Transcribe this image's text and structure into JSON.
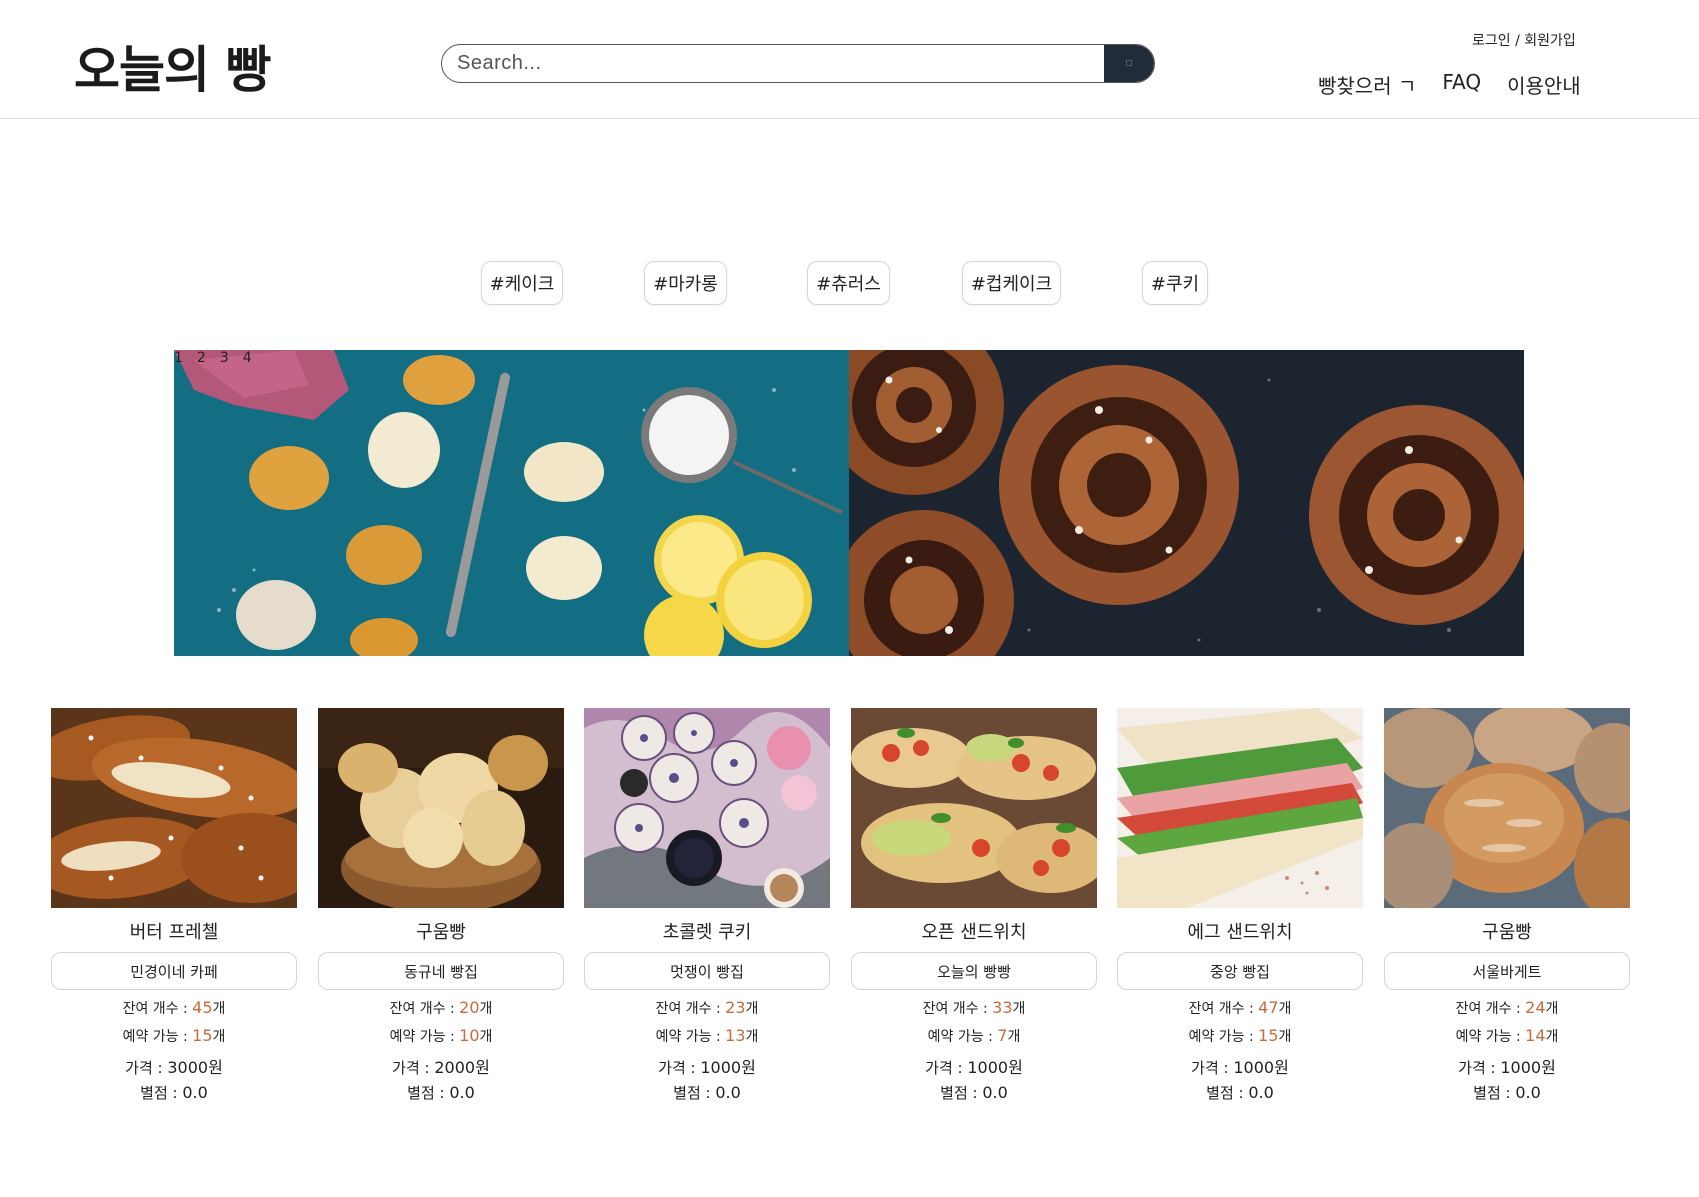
{
  "header": {
    "logo": "오늘의 빵",
    "search": {
      "placeholder": "Search...",
      "value": ""
    },
    "auth": {
      "login": "로그인",
      "separator": "/",
      "signup": "회원가입"
    },
    "nav": [
      "빵찾으러 ㄱ",
      "FAQ",
      "이용안내"
    ]
  },
  "tags": [
    "#케이크",
    "#마카롱",
    "#츄러스",
    "#컵케이크",
    "#쿠키"
  ],
  "slider": {
    "indicators": [
      "1",
      "2",
      "3",
      "4"
    ],
    "slides": [
      "madeleines-on-teal",
      "cinnamon-rolls-on-dark"
    ]
  },
  "products": [
    {
      "name": "버터 프레첼",
      "store": "민경이네 카페",
      "stock_label": "잔여 개수 : ",
      "stock": "45",
      "reserve_label": "예약 가능 : ",
      "reserve": "15",
      "unit": "개",
      "price_label": "가격 : ",
      "price": "3000원",
      "rating_label": "별점 : ",
      "rating": "0.0",
      "image": "pretzel"
    },
    {
      "name": "구움빵",
      "store": "동규네 빵집",
      "stock_label": "잔여 개수 : ",
      "stock": "20",
      "reserve_label": "예약 가능 : ",
      "reserve": "10",
      "unit": "개",
      "price_label": "가격 : ",
      "price": "2000원",
      "rating_label": "별점 : ",
      "rating": "0.0",
      "image": "bread-basket"
    },
    {
      "name": "초콜렛 쿠키",
      "store": "멋쟁이 빵집",
      "stock_label": "잔여 개수 : ",
      "stock": "23",
      "reserve_label": "예약 가능 : ",
      "reserve": "13",
      "unit": "개",
      "price_label": "가격 : ",
      "price": "1000원",
      "rating_label": "별점 : ",
      "rating": "0.0",
      "image": "cookies"
    },
    {
      "name": "오픈 샌드위치",
      "store": "오늘의 빵빵",
      "stock_label": "잔여 개수 : ",
      "stock": "33",
      "reserve_label": "예약 가능 : ",
      "reserve": "7",
      "unit": "개",
      "price_label": "가격 : ",
      "price": "1000원",
      "rating_label": "별점 : ",
      "rating": "0.0",
      "image": "bruschetta"
    },
    {
      "name": "에그 샌드위치",
      "store": "중앙 빵집",
      "stock_label": "잔여 개수 : ",
      "stock": "47",
      "reserve_label": "예약 가능 : ",
      "reserve": "15",
      "unit": "개",
      "price_label": "가격 : ",
      "price": "1000원",
      "rating_label": "별점 : ",
      "rating": "0.0",
      "image": "sandwich"
    },
    {
      "name": "구움빵",
      "store": "서울바게트",
      "stock_label": "잔여 개수 : ",
      "stock": "24",
      "reserve_label": "예약 가능 : ",
      "reserve": "14",
      "unit": "개",
      "price_label": "가격 : ",
      "price": "1000원",
      "rating_label": "별점 : ",
      "rating": "0.0",
      "image": "rustic-loaves"
    }
  ],
  "colors": {
    "accent": "#c96a3a",
    "search_button": "#222b38",
    "border": "#d4d4d4"
  }
}
